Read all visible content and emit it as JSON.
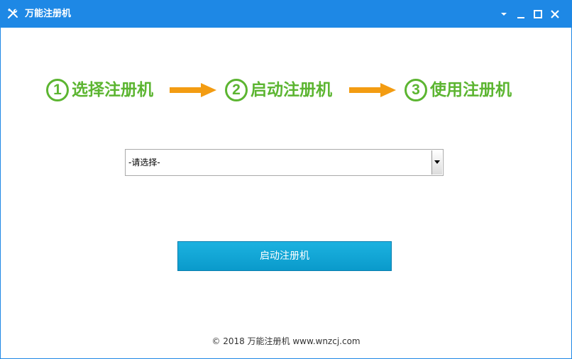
{
  "window": {
    "title": "万能注册机",
    "icon": "tools-icon",
    "controls": [
      "menu-icon",
      "minimize-icon",
      "maximize-icon",
      "close-icon"
    ]
  },
  "steps": [
    {
      "num": "1",
      "label": "选择注册机"
    },
    {
      "num": "2",
      "label": "启动注册机"
    },
    {
      "num": "3",
      "label": "使用注册机"
    }
  ],
  "select": {
    "value": "-请选择-"
  },
  "start_button": {
    "label": "启动注册机"
  },
  "footer": {
    "text": "© 2018 万能注册机 www.wnzcj.com"
  },
  "colors": {
    "titlebar": "#1e88e5",
    "step_green": "#5cb531",
    "arrow_orange": "#f39c12",
    "button_blue": "#13a6d6"
  }
}
